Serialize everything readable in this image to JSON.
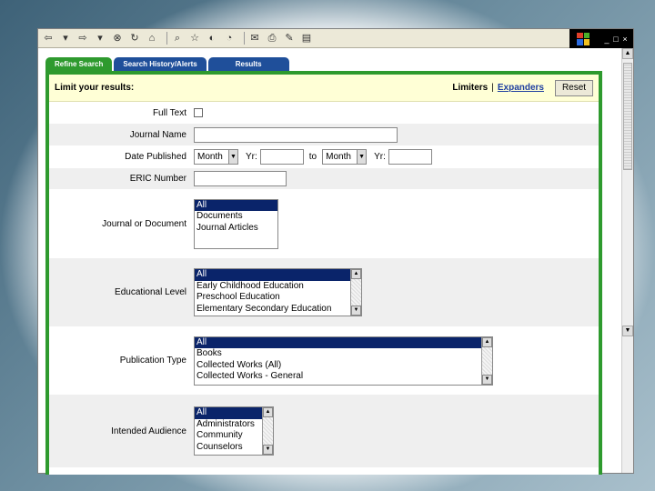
{
  "toolbar": {
    "icons": [
      "back-icon",
      "dropdown-icon",
      "forward-icon",
      "dropdown-icon",
      "stop-icon",
      "refresh-icon",
      "home-icon",
      "search-icon",
      "favorites-icon",
      "media-icon",
      "history-icon",
      "mail-icon",
      "print-icon",
      "edit-icon",
      "discuss-icon"
    ],
    "glyphs": [
      "⇦",
      "▾",
      "⇨",
      "▾",
      "⊗",
      "↻",
      "⌂",
      "⌕",
      "☆",
      "◐",
      "◔",
      "✉",
      "⎙",
      "✎",
      "▤"
    ],
    "window_controls": [
      "_",
      "□",
      "×"
    ]
  },
  "tabs": [
    {
      "label": "Refine Search",
      "active": true
    },
    {
      "label": "Search History/Alerts",
      "active": false
    },
    {
      "label": "Results",
      "active": false
    }
  ],
  "limits": {
    "title": "Limit your results:",
    "limiters_label": "Limiters",
    "separator": "|",
    "expanders_label": "Expanders",
    "reset_label": "Reset"
  },
  "form": {
    "full_text_label": "Full Text",
    "journal_name_label": "Journal Name",
    "date_published_label": "Date Published",
    "month_from": "Month",
    "yr_label": "Yr:",
    "to_label": "to",
    "month_to": "Month",
    "yr_label2": "Yr:",
    "eric_number_label": "ERIC Number",
    "journal_or_document": {
      "label": "Journal or Document",
      "options": [
        "All",
        "Documents",
        "Journal Articles"
      ]
    },
    "educational_level": {
      "label": "Educational Level",
      "options": [
        "All",
        "Early Childhood Education",
        "Preschool Education",
        "Elementary Secondary Education"
      ]
    },
    "publication_type": {
      "label": "Publication Type",
      "options": [
        "All",
        "Books",
        "Collected Works (All)",
        "Collected Works - General"
      ]
    },
    "intended_audience": {
      "label": "Intended Audience",
      "options": [
        "All",
        "Administrators",
        "Community",
        "Counselors"
      ]
    }
  }
}
